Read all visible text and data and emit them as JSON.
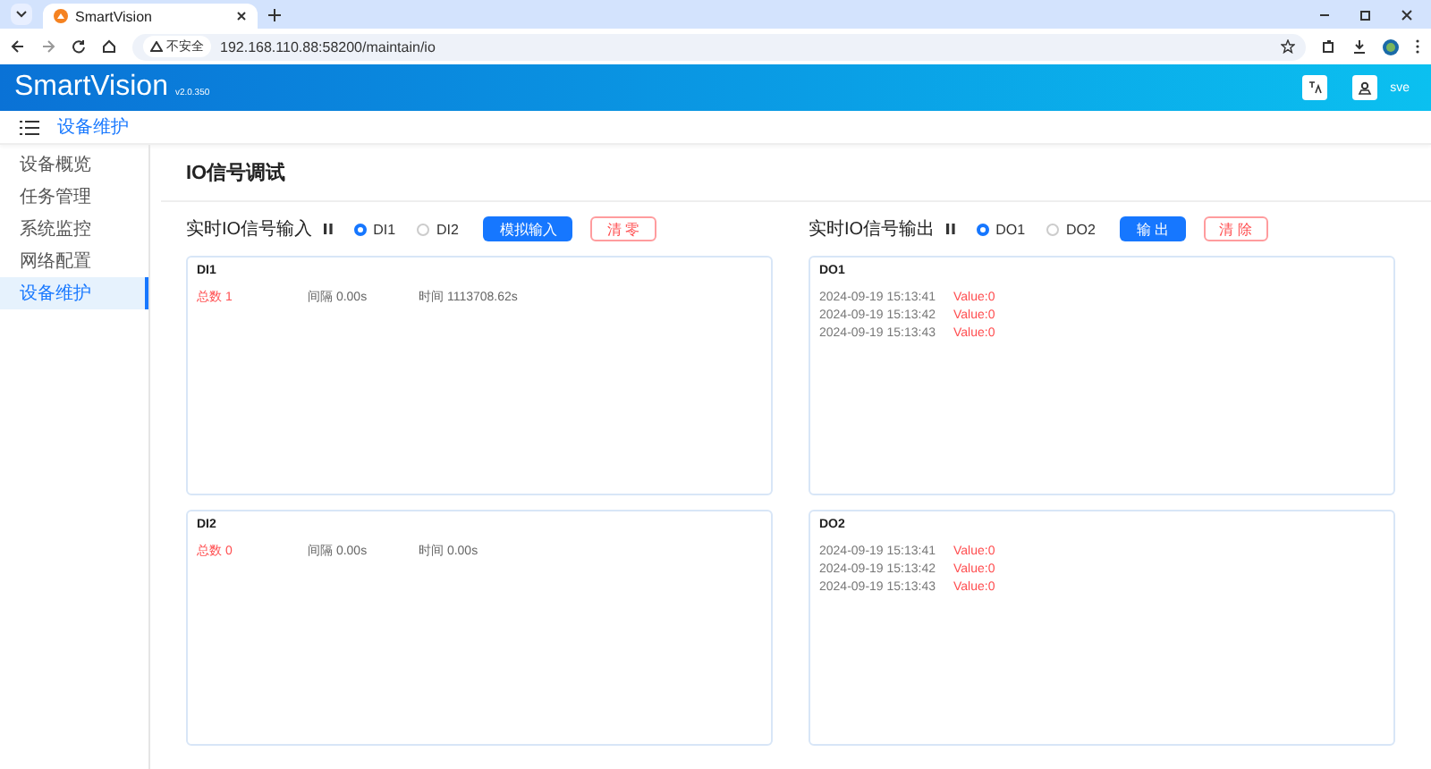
{
  "browser": {
    "tab_title": "SmartVision",
    "security": "不安全",
    "url": "192.168.110.88:58200/maintain/io"
  },
  "header": {
    "app_name": "SmartVision",
    "version": "v2.0.350",
    "user": "sve"
  },
  "breadcrumb": "设备维护",
  "sidebar": {
    "items": [
      {
        "label": "设备概览",
        "selected": false
      },
      {
        "label": "任务管理",
        "selected": false
      },
      {
        "label": "系统监控",
        "selected": false
      },
      {
        "label": "网络配置",
        "selected": false
      },
      {
        "label": "设备维护",
        "selected": true
      }
    ]
  },
  "page_title": "IO信号调试",
  "input": {
    "title": "实时IO信号输入",
    "radios": [
      {
        "label": "DI1",
        "selected": true
      },
      {
        "label": "DI2",
        "selected": false
      }
    ],
    "primary_button": "模拟输入",
    "clear_button": "清 零",
    "panels": [
      {
        "title": "DI1",
        "count": "总数 1",
        "interval": "间隔 0.00s",
        "time": "时间 1113708.62s"
      },
      {
        "title": "DI2",
        "count": "总数 0",
        "interval": "间隔 0.00s",
        "time": "时间 0.00s"
      }
    ]
  },
  "output": {
    "title": "实时IO信号输出",
    "radios": [
      {
        "label": "DO1",
        "selected": true
      },
      {
        "label": "DO2",
        "selected": false
      }
    ],
    "primary_button": "输 出",
    "clear_button": "清 除",
    "panels": [
      {
        "title": "DO1",
        "logs": [
          {
            "time": "2024-09-19 15:13:41",
            "value": "Value:0"
          },
          {
            "time": "2024-09-19 15:13:42",
            "value": "Value:0"
          },
          {
            "time": "2024-09-19 15:13:43",
            "value": "Value:0"
          }
        ]
      },
      {
        "title": "DO2",
        "logs": [
          {
            "time": "2024-09-19 15:13:41",
            "value": "Value:0"
          },
          {
            "time": "2024-09-19 15:13:42",
            "value": "Value:0"
          },
          {
            "time": "2024-09-19 15:13:43",
            "value": "Value:0"
          }
        ]
      }
    ]
  }
}
